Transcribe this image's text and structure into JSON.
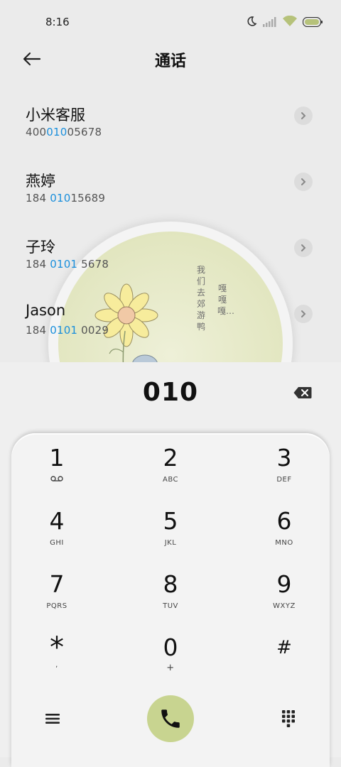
{
  "status_bar": {
    "time": "8:16",
    "icons": [
      "moon-icon",
      "signal-icon",
      "wifi-icon",
      "battery-icon"
    ]
  },
  "header": {
    "title": "通话"
  },
  "contacts": [
    {
      "name": "小米客服",
      "number_parts": [
        "400",
        "010",
        "05678"
      ],
      "highlight_index": 1
    },
    {
      "name": "燕婷",
      "number_parts": [
        "184 ",
        "010",
        "15689"
      ],
      "highlight_index": 1
    },
    {
      "name": "子玲",
      "number_parts": [
        "184 ",
        "0101",
        " 5678"
      ],
      "highlight_index": 1
    },
    {
      "name": "Jason",
      "number_parts": [
        "184 ",
        "0101",
        " 0029"
      ],
      "highlight_index": 1
    }
  ],
  "artwork": {
    "caption_left": "我们去郊游鸭",
    "caption_right": "嘎嘎嘎…"
  },
  "dialer": {
    "input": "010",
    "keys": [
      {
        "digit": "1",
        "letters": ""
      },
      {
        "digit": "2",
        "letters": "ABC"
      },
      {
        "digit": "3",
        "letters": "DEF"
      },
      {
        "digit": "4",
        "letters": "GHI"
      },
      {
        "digit": "5",
        "letters": "JKL"
      },
      {
        "digit": "6",
        "letters": "MNO"
      },
      {
        "digit": "7",
        "letters": "PQRS"
      },
      {
        "digit": "8",
        "letters": "TUV"
      },
      {
        "digit": "9",
        "letters": "WXYZ"
      },
      {
        "digit": "*",
        "letters": ","
      },
      {
        "digit": "0",
        "letters": "+"
      },
      {
        "digit": "#",
        "letters": ""
      }
    ]
  },
  "colors": {
    "highlight": "#1a8fdc",
    "call_button": "#c8d490"
  }
}
